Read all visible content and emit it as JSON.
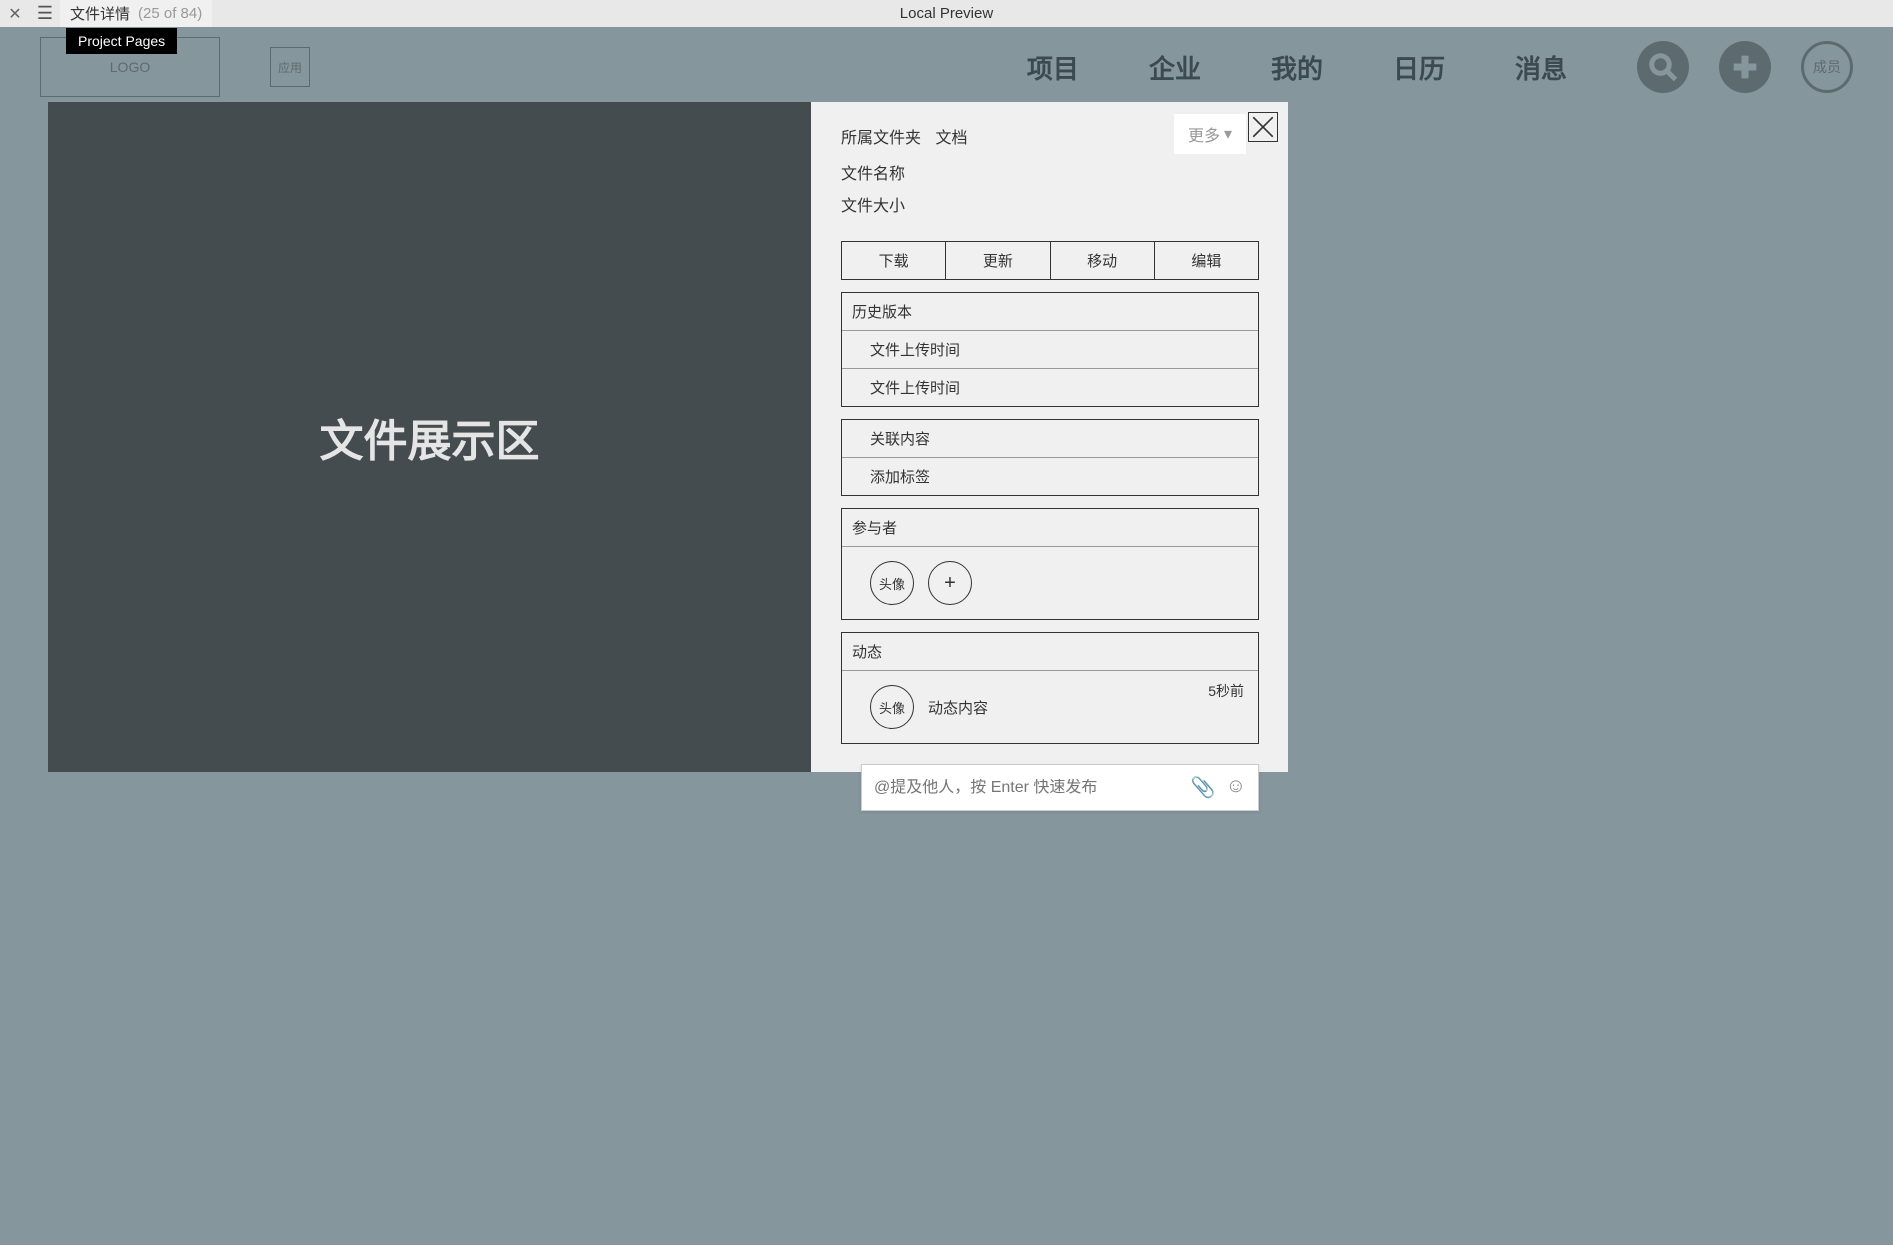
{
  "topbar": {
    "page_title": "文件详情",
    "counter": "(25 of 84)",
    "center_title": "Local Preview",
    "tooltip": "Project Pages"
  },
  "header": {
    "logo": "LOGO",
    "app_btn": "应用",
    "nav": [
      "项目",
      "企业",
      "我的",
      "日历",
      "消息"
    ],
    "member": "成员"
  },
  "modal": {
    "display_area": "文件展示区",
    "more": "更多",
    "folder_label": "所属文件夹",
    "folder_value": "文档",
    "file_name_label": "文件名称",
    "file_size_label": "文件大小",
    "actions": [
      "下载",
      "更新",
      "移动",
      "编辑"
    ],
    "history_header": "历史版本",
    "history_items": [
      "文件上传时间",
      "文件上传时间"
    ],
    "related_header": "关联内容",
    "add_tag": "添加标签",
    "participants_header": "参与者",
    "avatar_label": "头像",
    "activity_header": "动态",
    "activity_avatar": "头像",
    "activity_content": "动态内容",
    "activity_time": "5秒前",
    "comment_placeholder": "@提及他人，按 Enter 快速发布"
  }
}
